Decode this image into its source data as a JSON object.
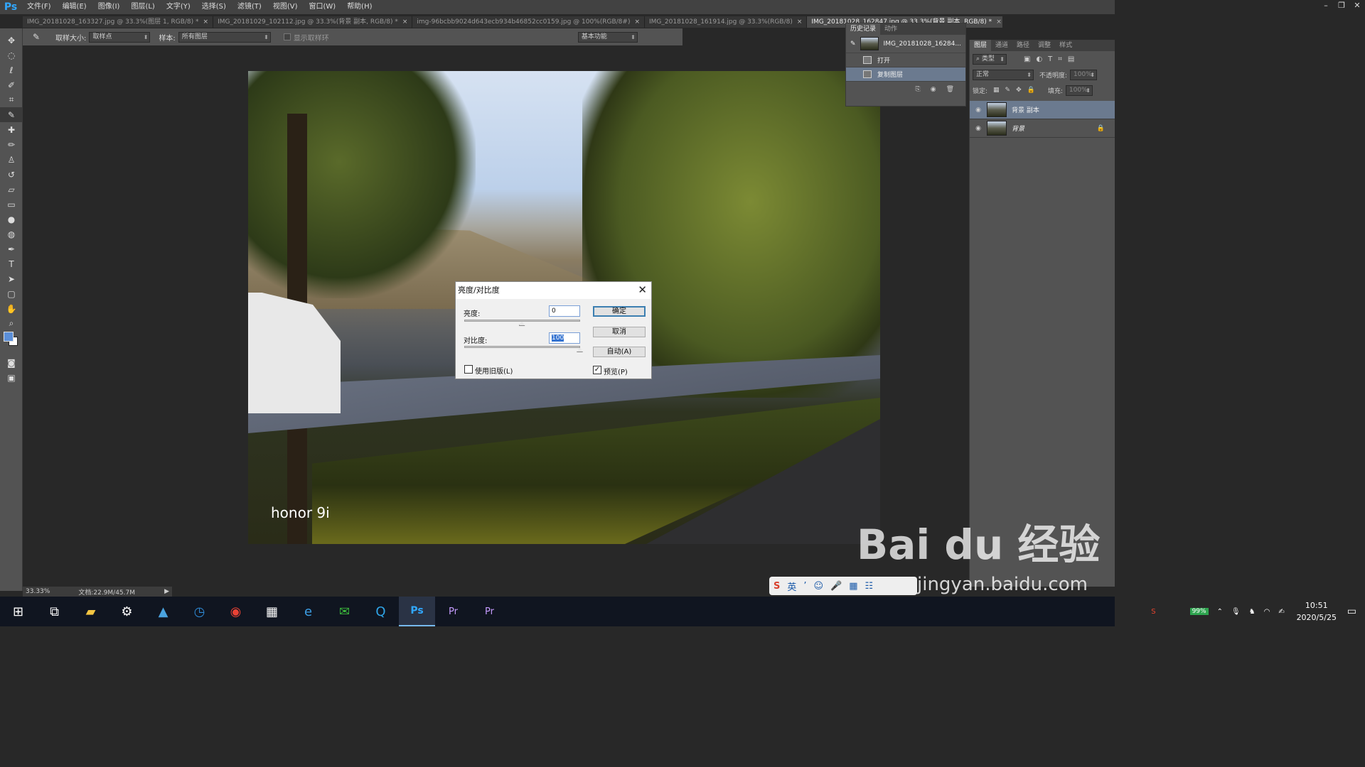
{
  "app": {
    "logo": "Ps",
    "menus": [
      "文件(F)",
      "编辑(E)",
      "图像(I)",
      "图层(L)",
      "文字(Y)",
      "选择(S)",
      "滤镜(T)",
      "视图(V)",
      "窗口(W)",
      "帮助(H)"
    ]
  },
  "tabs": [
    {
      "label": "IMG_20181028_163327.jpg @ 33.3%(图层 1, RGB/8) *"
    },
    {
      "label": "IMG_20181029_102112.jpg @ 33.3%(背景 副本, RGB/8) *"
    },
    {
      "label": "img-96bcbb9024d643ecb934b46852cc0159.jpg @ 100%(RGB/8#)"
    },
    {
      "label": "IMG_20181028_161914.jpg @ 33.3%(RGB/8)"
    },
    {
      "label": "IMG_20181028_162847.jpg @ 33.3%(背景 副本, RGB/8) *"
    }
  ],
  "options": {
    "sample_size_label": "取样大小:",
    "sample_size": "取样点",
    "sample_label": "样本:",
    "sample": "所有图层",
    "show_ring": "显示取样环",
    "workspace": "基本功能"
  },
  "dialog": {
    "title": "亮度/对比度",
    "brightness_label": "亮度:",
    "brightness": "0",
    "contrast_label": "对比度:",
    "contrast": "100",
    "brightness_fraction": 0.5,
    "contrast_fraction": 1.0,
    "ok": "确定",
    "cancel": "取消",
    "auto": "自动(A)",
    "legacy": "使用旧版(L)",
    "legacy_checked": false,
    "preview": "预览(P)",
    "preview_checked": true
  },
  "history": {
    "tabs": [
      "历史记录",
      "动作"
    ],
    "snapshot": "IMG_20181028_16284...",
    "steps": [
      "打开",
      "复制图层"
    ]
  },
  "layers": {
    "tabs": [
      "图层",
      "通道",
      "路径",
      "调整",
      "样式"
    ],
    "filter": "类型",
    "blend": "正常",
    "opacity_label": "不透明度:",
    "opacity": "100%",
    "lock_label": "锁定:",
    "fill_label": "填充:",
    "fill": "100%",
    "items": [
      "背景 副本",
      "背景"
    ]
  },
  "photo": {
    "brand": "honor 9i"
  },
  "status": {
    "zoom": "33.33%",
    "doc": "文档:22.9M/45.7M"
  },
  "taskbar": {
    "battery": "99%",
    "time": "10:51",
    "date": "2020/5/25"
  },
  "ime": {
    "lang": "英"
  },
  "watermark": {
    "text": "Bai du 经验",
    "url": "jingyan.baidu.com"
  }
}
